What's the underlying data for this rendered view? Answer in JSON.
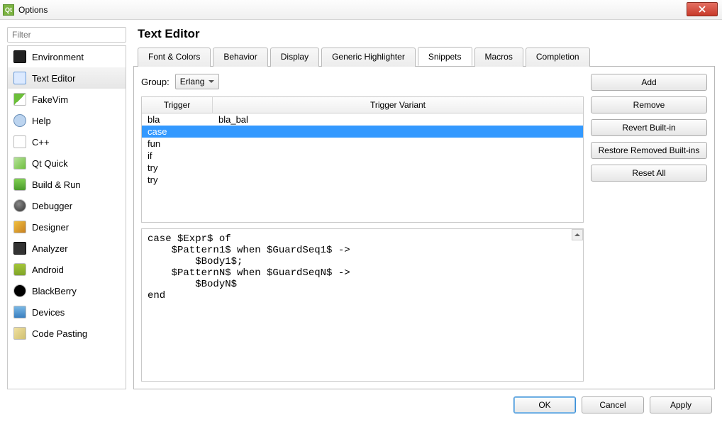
{
  "window": {
    "title": "Options"
  },
  "sidebar": {
    "filter_placeholder": "Filter",
    "items": [
      {
        "label": "Environment",
        "icon": "ic-env"
      },
      {
        "label": "Text Editor",
        "icon": "ic-tex",
        "selected": true
      },
      {
        "label": "FakeVim",
        "icon": "ic-fak"
      },
      {
        "label": "Help",
        "icon": "ic-hel"
      },
      {
        "label": "C++",
        "icon": "ic-cpp"
      },
      {
        "label": "Qt Quick",
        "icon": "ic-qtq"
      },
      {
        "label": "Build & Run",
        "icon": "ic-bld"
      },
      {
        "label": "Debugger",
        "icon": "ic-dbg"
      },
      {
        "label": "Designer",
        "icon": "ic-des"
      },
      {
        "label": "Analyzer",
        "icon": "ic-ana"
      },
      {
        "label": "Android",
        "icon": "ic-and"
      },
      {
        "label": "BlackBerry",
        "icon": "ic-bla"
      },
      {
        "label": "Devices",
        "icon": "ic-dev"
      },
      {
        "label": "Code Pasting",
        "icon": "ic-cod"
      }
    ]
  },
  "page": {
    "title": "Text Editor"
  },
  "tabs": [
    {
      "label": "Font & Colors"
    },
    {
      "label": "Behavior"
    },
    {
      "label": "Display"
    },
    {
      "label": "Generic Highlighter"
    },
    {
      "label": "Snippets",
      "active": true
    },
    {
      "label": "Macros"
    },
    {
      "label": "Completion"
    }
  ],
  "snippets": {
    "group_label": "Group:",
    "group_value": "Erlang",
    "columns": {
      "trigger": "Trigger",
      "variant": "Trigger Variant"
    },
    "rows": [
      {
        "trigger": "bla",
        "variant": "bla_bal"
      },
      {
        "trigger": "case",
        "variant": "",
        "selected": true
      },
      {
        "trigger": "fun",
        "variant": ""
      },
      {
        "trigger": "if",
        "variant": ""
      },
      {
        "trigger": "try",
        "variant": ""
      },
      {
        "trigger": "try",
        "variant": ""
      }
    ],
    "code": "case $Expr$ of\n    $Pattern1$ when $GuardSeq1$ ->\n        $Body1$;\n    $PatternN$ when $GuardSeqN$ ->\n        $BodyN$\nend"
  },
  "side_buttons": {
    "add": "Add",
    "remove": "Remove",
    "revert": "Revert Built-in",
    "restore": "Restore Removed Built-ins",
    "reset": "Reset All"
  },
  "footer": {
    "ok": "OK",
    "cancel": "Cancel",
    "apply": "Apply"
  }
}
